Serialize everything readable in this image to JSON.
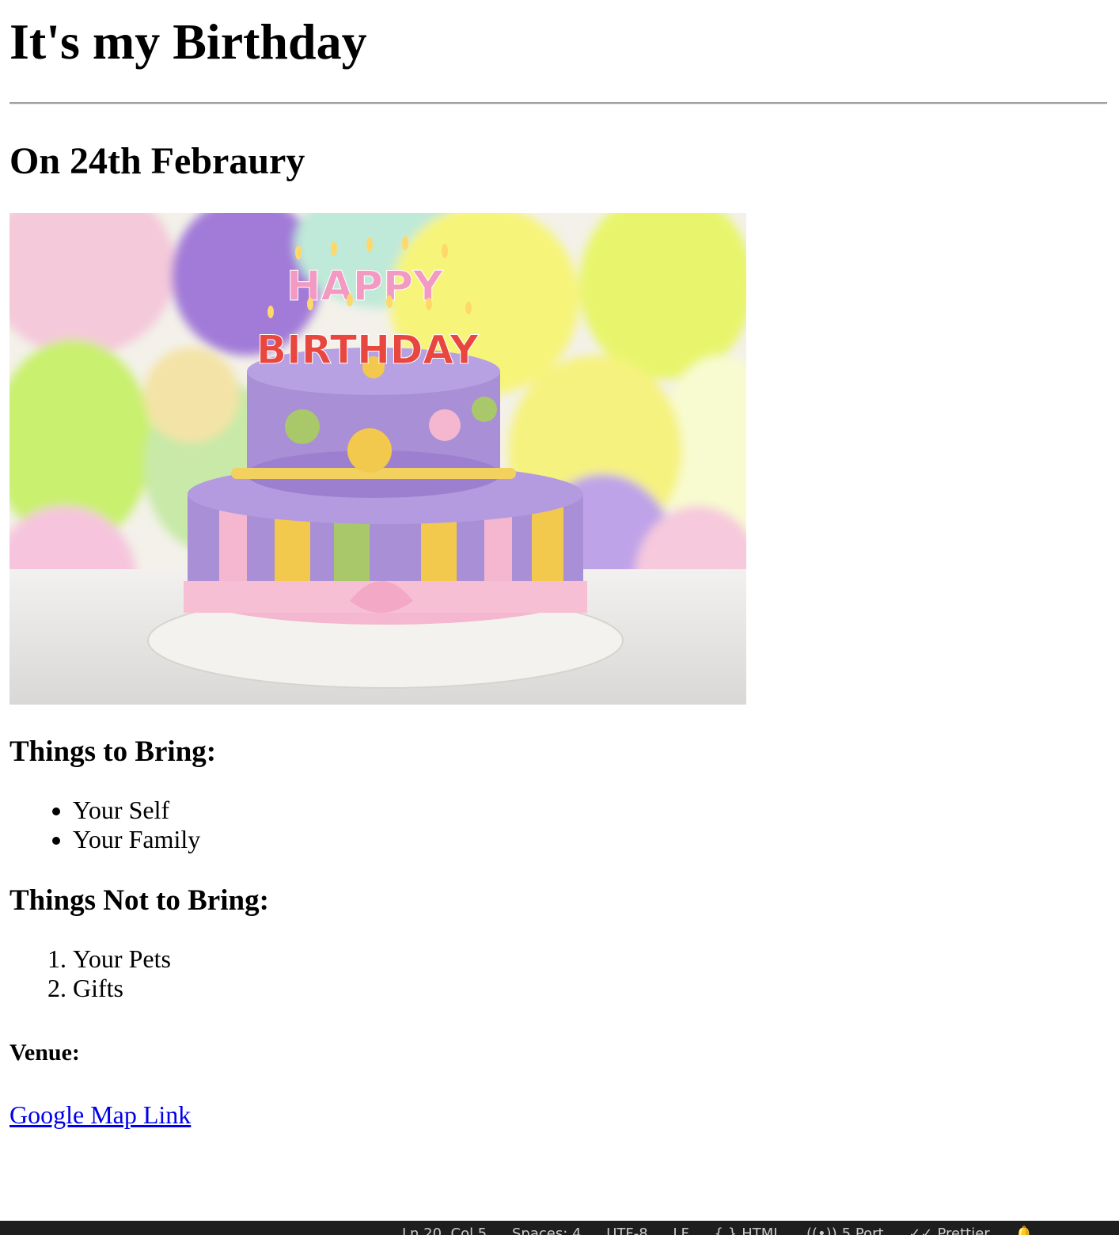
{
  "page": {
    "title": "It's my Birthday",
    "date_heading": "On 24th Febraury",
    "hero_image": {
      "alt": "Happy Birthday cake",
      "candle_text_top": "HAPPY",
      "candle_text_bottom": "BIRTHDAY"
    },
    "bring_heading": "Things to Bring:",
    "bring_items": [
      "Your Self",
      "Your Family"
    ],
    "not_bring_heading": "Things Not to Bring:",
    "not_bring_items": [
      "Your Pets",
      "Gifts"
    ],
    "venue_heading": "Venue:",
    "map_link_text": "Google Map Link"
  },
  "colors": {
    "link": "#0000ee",
    "statusbar_bg": "#1e1e1e",
    "statusbar_text": "#cccccc",
    "cake_purple": "#a98fd6",
    "cake_yellow": "#f2c94c",
    "cake_green": "#a9c86a",
    "cake_pink": "#f4b7cf"
  },
  "statusbar": {
    "cursor_position": "Ln 20, Col 5",
    "indentation": "Spaces: 4",
    "encoding": "UTF-8",
    "line_ending": "LF",
    "language": "HTML",
    "live_server": "5 Port",
    "prettier": "Prettier",
    "icons": [
      "braces-icon",
      "broadcast-icon",
      "double-check-icon",
      "bell-icon"
    ]
  }
}
